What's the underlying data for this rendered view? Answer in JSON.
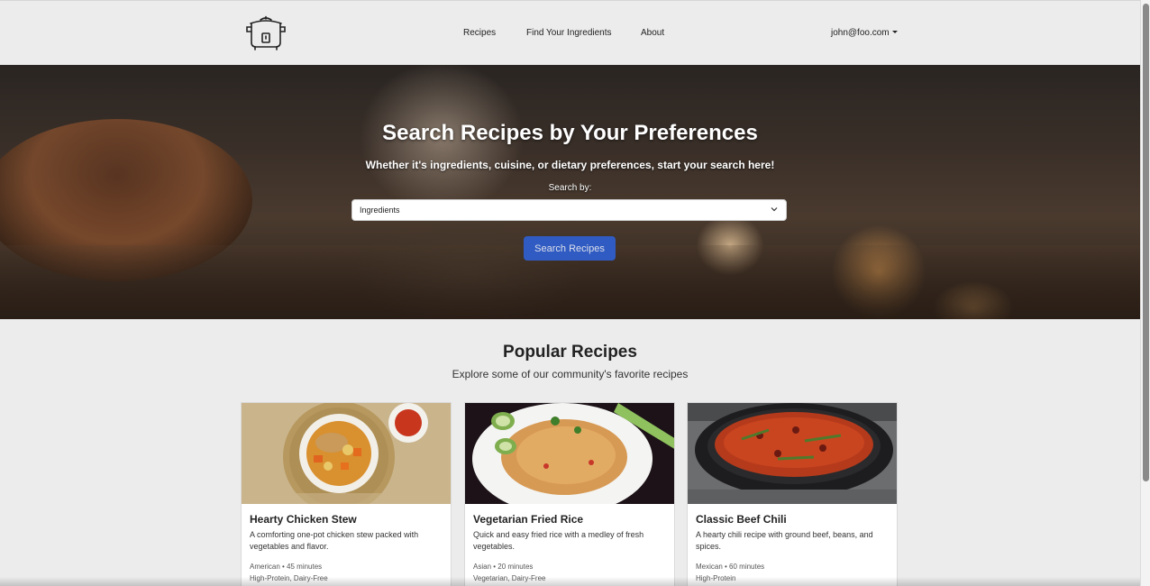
{
  "nav": {
    "links": [
      {
        "label": "Recipes"
      },
      {
        "label": "Find Your Ingredients"
      },
      {
        "label": "About"
      }
    ],
    "user_email": "john@foo.com",
    "logo_icon": "slow-cooker-icon"
  },
  "hero": {
    "title": "Search Recipes by Your Preferences",
    "subtitle": "Whether it's ingredients, cuisine, or dietary preferences, start your search here!",
    "search_by_label": "Search by:",
    "select_value": "Ingredients",
    "button_label": "Search Recipes",
    "button_color": "#2f5fd0"
  },
  "popular": {
    "title": "Popular Recipes",
    "subtitle": "Explore some of our community's favorite recipes",
    "cards": [
      {
        "title": "Hearty Chicken Stew",
        "description": "A comforting one-pot chicken stew packed with vegetables and flavor.",
        "meta": "American • 45 minutes",
        "tags": "High-Protein, Dairy-Free",
        "image": "chicken-stew-photo"
      },
      {
        "title": "Vegetarian Fried Rice",
        "description": "Quick and easy fried rice with a medley of fresh vegetables.",
        "meta": "Asian • 20 minutes",
        "tags": "Vegetarian, Dairy-Free",
        "image": "fried-rice-photo"
      },
      {
        "title": "Classic Beef Chili",
        "description": "A hearty chili recipe with ground beef, beans, and spices.",
        "meta": "Mexican • 60 minutes",
        "tags": "High-Protein",
        "image": "beef-chili-photo"
      }
    ]
  }
}
